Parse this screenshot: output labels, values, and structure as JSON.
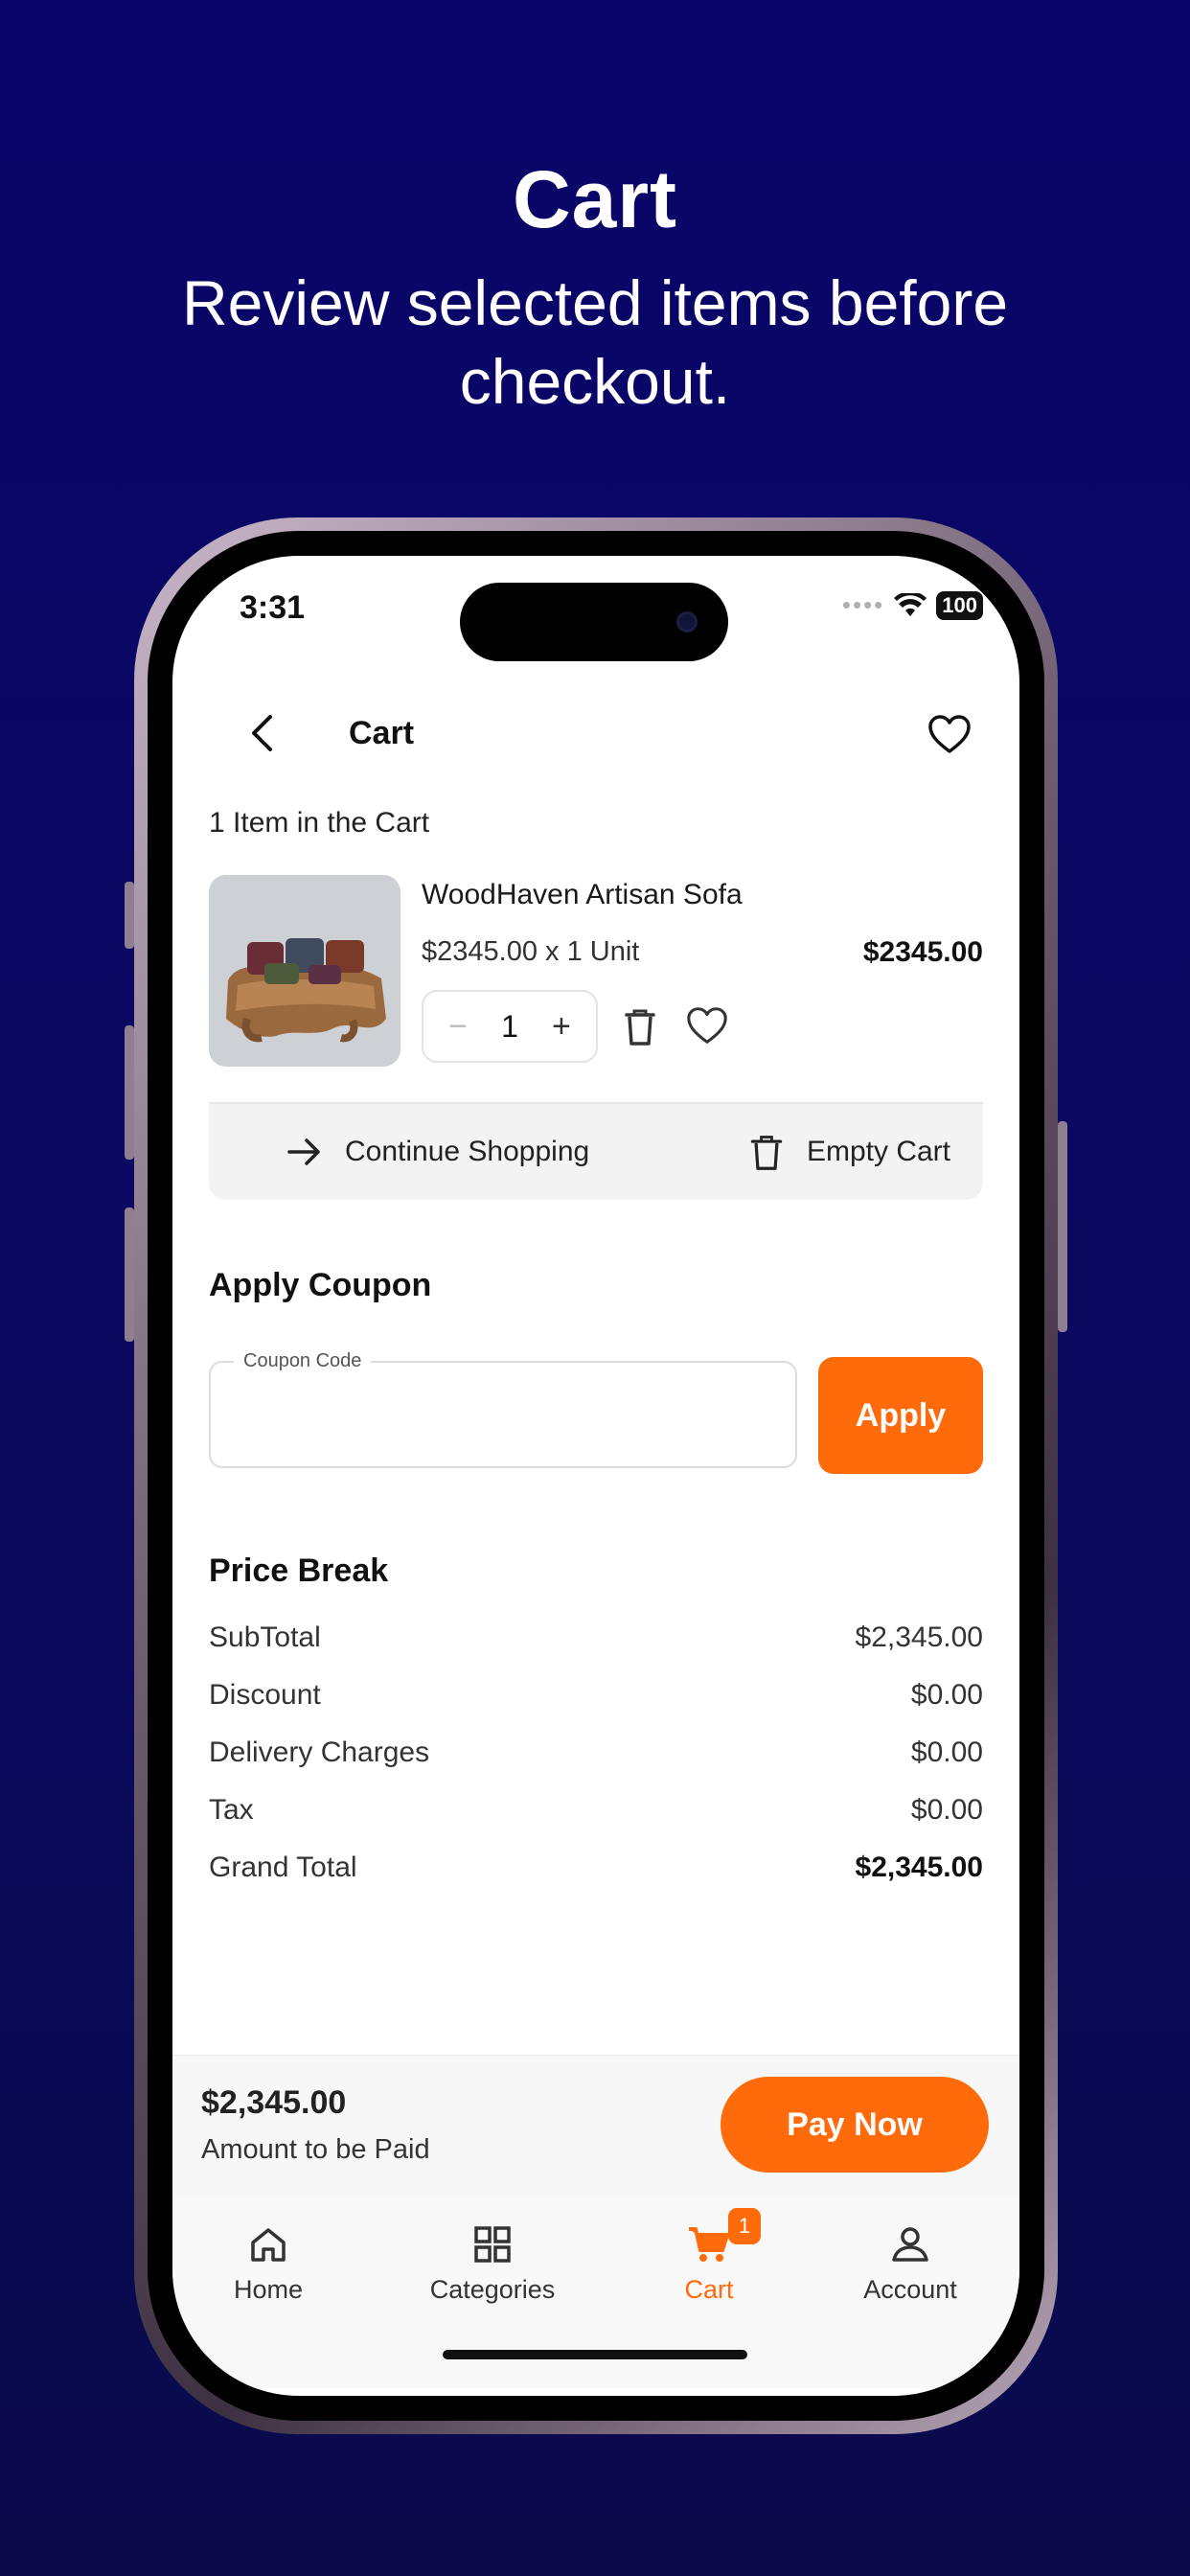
{
  "promo": {
    "title": "Cart",
    "subtitle": "Review selected items before checkout."
  },
  "status_bar": {
    "time": "3:31",
    "battery": "100"
  },
  "header": {
    "title": "Cart",
    "back_icon": "chevron-left-icon",
    "favorite_icon": "heart-icon"
  },
  "cart": {
    "count_text": "1 Item in the Cart",
    "items": [
      {
        "name": "WoodHaven Artisan Sofa",
        "unit_price_text": "$2345.00 x 1 Unit",
        "total": "$2345.00",
        "quantity": "1",
        "decrement_icon": "minus-icon",
        "increment_icon": "plus-icon"
      }
    ],
    "actions": {
      "continue_label": "Continue Shopping",
      "empty_label": "Empty Cart"
    }
  },
  "coupon": {
    "section_title": "Apply Coupon",
    "field_label": "Coupon Code",
    "value": "",
    "apply_label": "Apply"
  },
  "price_break": {
    "section_title": "Price Break",
    "rows": [
      {
        "label": "SubTotal",
        "value": "$2,345.00"
      },
      {
        "label": "Discount",
        "value": "$0.00"
      },
      {
        "label": "Delivery Charges",
        "value": "$0.00"
      },
      {
        "label": "Tax",
        "value": "$0.00"
      },
      {
        "label": "Grand Total",
        "value": "$2,345.00"
      }
    ]
  },
  "pay_bar": {
    "amount": "$2,345.00",
    "caption": "Amount to be Paid",
    "button_label": "Pay Now"
  },
  "tab_bar": {
    "tabs": [
      {
        "label": "Home",
        "icon": "home-icon"
      },
      {
        "label": "Categories",
        "icon": "grid-icon"
      },
      {
        "label": "Cart",
        "icon": "cart-icon",
        "badge": "1",
        "active": true
      },
      {
        "label": "Account",
        "icon": "user-icon"
      }
    ]
  },
  "colors": {
    "accent": "#ff6b0a",
    "background": "#0a056a",
    "screen": "#ffffff"
  }
}
